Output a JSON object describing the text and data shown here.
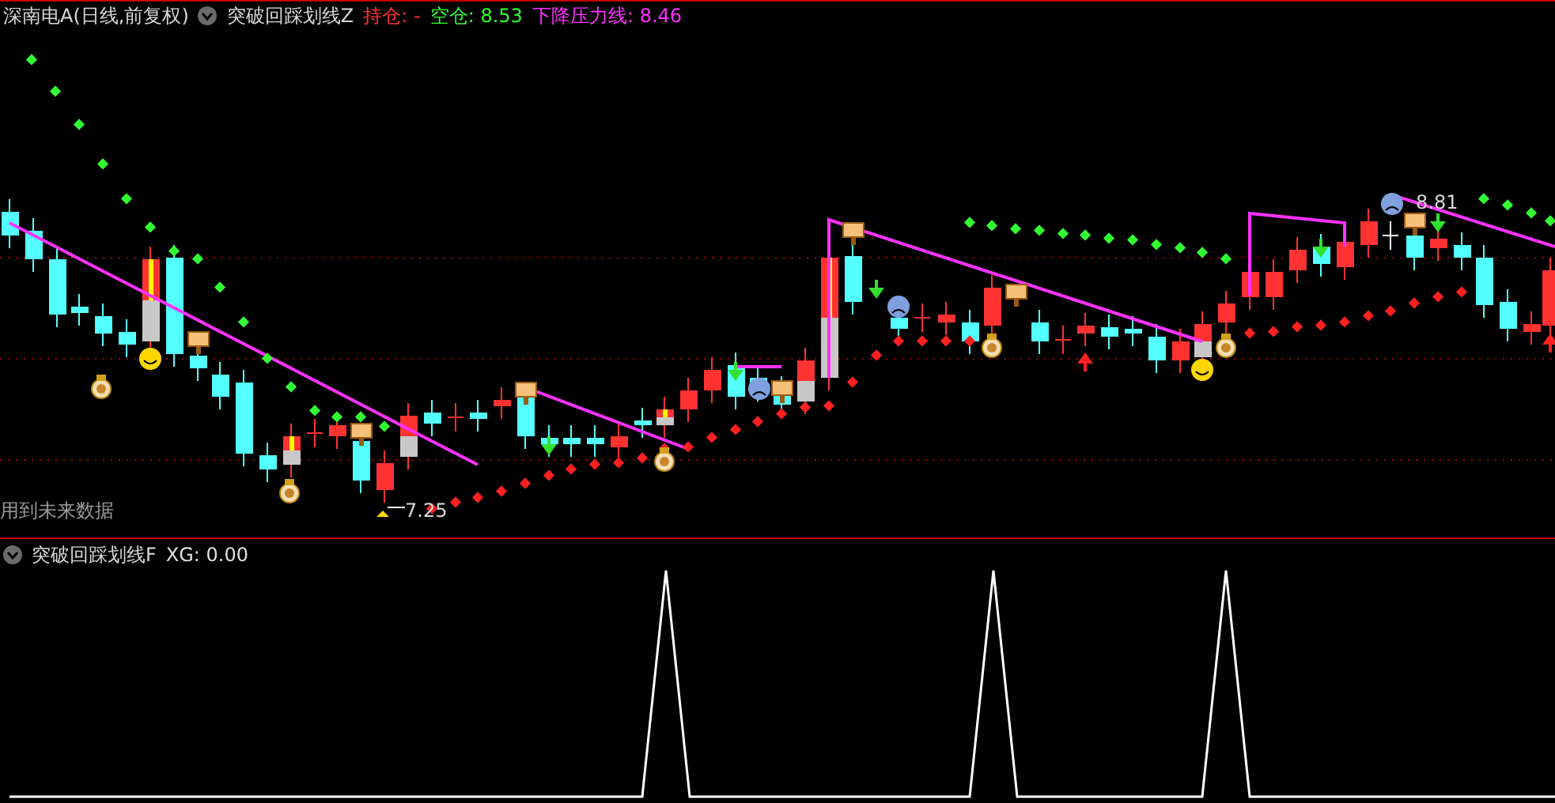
{
  "main_panel": {
    "security": "深南电A(日线,前复权)",
    "indicator": "突破回踩划线Z",
    "readings": [
      {
        "label": "持仓:",
        "value": "-",
        "color": "#ff3232"
      },
      {
        "label": "空仓:",
        "value": "8.53",
        "color": "#32ff32"
      },
      {
        "label": "下降压力线:",
        "value": "8.46",
        "color": "#ff32ff"
      }
    ],
    "price_labels": [
      {
        "text": "8.81"
      },
      {
        "text": "7.25"
      }
    ],
    "warning": "用到未来数据"
  },
  "sub_panel": {
    "indicator": "突破回踩划线F",
    "readings": [
      {
        "label": "XG:",
        "value": "0.00",
        "color": "#e0e0e0"
      }
    ]
  }
}
